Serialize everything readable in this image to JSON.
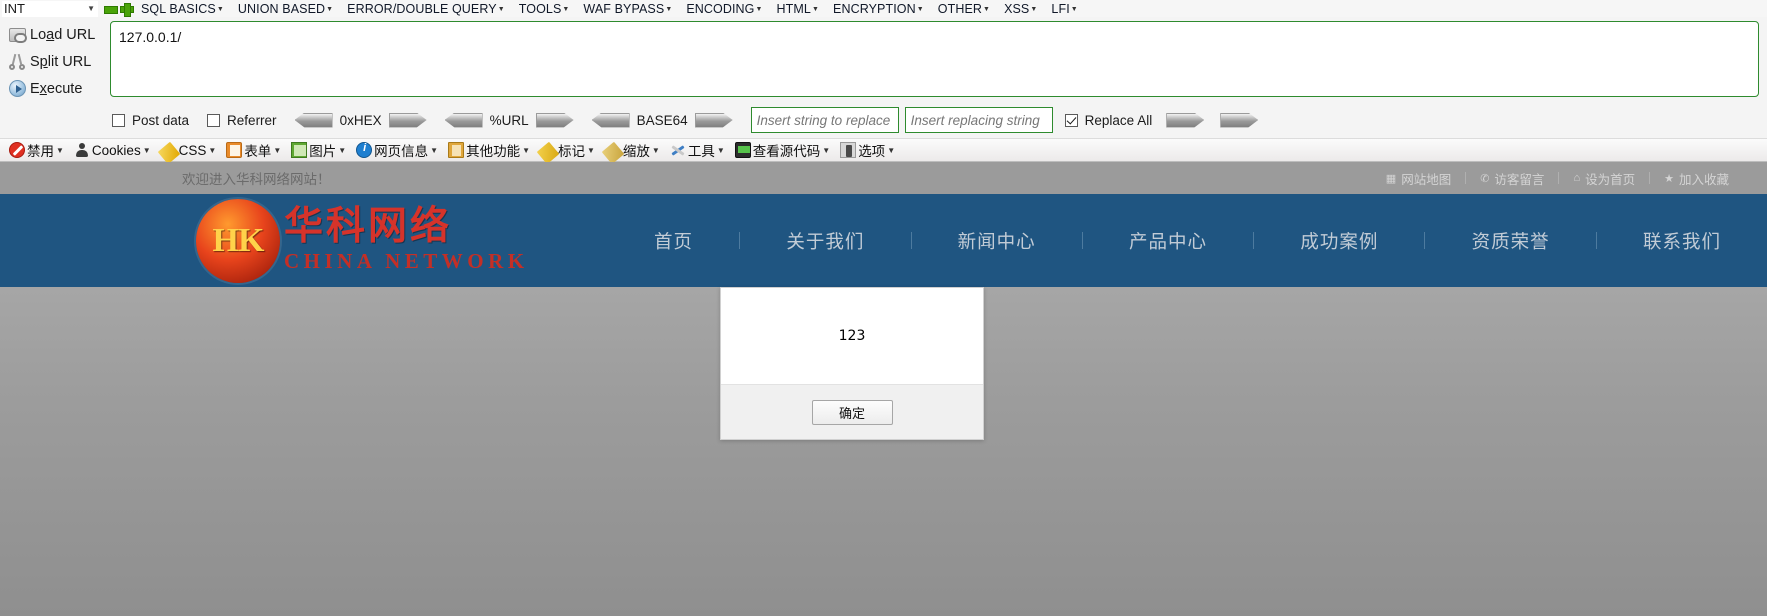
{
  "hackbar": {
    "type_selector": {
      "value": "INT",
      "caret": "chevron-down-icon"
    },
    "menus": [
      {
        "label": "SQL BASICS"
      },
      {
        "label": "UNION BASED"
      },
      {
        "label": "ERROR/DOUBLE QUERY"
      },
      {
        "label": "TOOLS"
      },
      {
        "label": "WAF BYPASS"
      },
      {
        "label": "ENCODING"
      },
      {
        "label": "HTML"
      },
      {
        "label": "ENCRYPTION"
      },
      {
        "label": "OTHER"
      },
      {
        "label": "XSS"
      },
      {
        "label": "LFI"
      }
    ],
    "actions": [
      {
        "label": "Load URL",
        "accel": "a",
        "icon": "load-url-icon"
      },
      {
        "label": "Split URL",
        "accel": "p",
        "icon": "split-url-icon"
      },
      {
        "label": "Execute",
        "accel": "x",
        "icon": "execute-icon"
      }
    ],
    "url_value": "127.0.0.1/",
    "url_placeholder": "",
    "options": {
      "post_data": {
        "label": "Post data",
        "checked": false
      },
      "referrer": {
        "label": "Referrer",
        "checked": false
      },
      "hex": {
        "label": "0xHEX"
      },
      "url": {
        "label": "%URL"
      },
      "base64": {
        "label": "BASE64"
      },
      "replace_from_placeholder": "Insert string to replace",
      "replace_from_value": "",
      "replace_to_placeholder": "Insert replacing string",
      "replace_to_value": "",
      "replace_all": {
        "label": "Replace All",
        "checked": true
      }
    }
  },
  "devtoolbar": {
    "items": [
      {
        "label": "禁用",
        "icon": "disable-icon"
      },
      {
        "label": "Cookies",
        "icon": "cookies-icon"
      },
      {
        "label": "CSS",
        "icon": "css-icon"
      },
      {
        "label": "表单",
        "icon": "forms-icon"
      },
      {
        "label": "图片",
        "icon": "images-icon"
      },
      {
        "label": "网页信息",
        "icon": "page-info-icon"
      },
      {
        "label": "其他功能",
        "icon": "misc-icon"
      },
      {
        "label": "标记",
        "icon": "outline-icon"
      },
      {
        "label": "缩放",
        "icon": "resize-icon"
      },
      {
        "label": "工具",
        "icon": "tools-icon"
      },
      {
        "label": "查看源代码",
        "icon": "view-source-icon"
      },
      {
        "label": "选项",
        "icon": "options-icon"
      }
    ]
  },
  "site": {
    "topbar": {
      "welcome": "欢迎进入华科网络网站！",
      "links": [
        {
          "label": "网站地图",
          "icon": "sitemap-icon"
        },
        {
          "label": "访客留言",
          "icon": "message-icon"
        },
        {
          "label": "设为首页",
          "icon": "home-icon"
        },
        {
          "label": "加入收藏",
          "icon": "star-icon"
        }
      ]
    },
    "brand": {
      "monogram": "HK",
      "name_cn": "华科网络",
      "name_en": "CHINA NETWORK"
    },
    "nav": [
      {
        "label": "首页"
      },
      {
        "label": "关于我们"
      },
      {
        "label": "新闻中心"
      },
      {
        "label": "产品中心"
      },
      {
        "label": "成功案例"
      },
      {
        "label": "资质荣誉"
      },
      {
        "label": "联系我们"
      }
    ],
    "dialog": {
      "message": "123",
      "ok_label": "确定"
    }
  },
  "colors": {
    "nav_bg": "#1f5581",
    "topbar_bg": "#9b9b9b",
    "brand_red": "#d6332a",
    "input_border_green": "#2e8b2e"
  }
}
